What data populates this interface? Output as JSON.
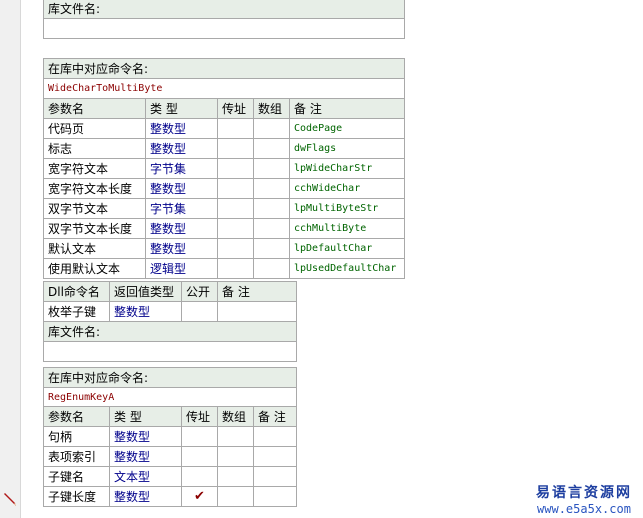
{
  "lib_file_label": "库文件名:",
  "lib_command_label": "在库中对应命令名:",
  "t1": {
    "command_name": "WideCharToMultiByte",
    "headers": [
      "参数名",
      "类 型",
      "传址",
      "数组",
      "备 注"
    ],
    "rows": [
      {
        "name": "代码页",
        "type": "整数型",
        "by_ref": "",
        "array": "",
        "note": "CodePage"
      },
      {
        "name": "标志",
        "type": "整数型",
        "by_ref": "",
        "array": "",
        "note": "dwFlags"
      },
      {
        "name": "宽字符文本",
        "type": "字节集",
        "by_ref": "",
        "array": "",
        "note": "lpWideCharStr"
      },
      {
        "name": "宽字符文本长度",
        "type": "整数型",
        "by_ref": "",
        "array": "",
        "note": "cchWideChar"
      },
      {
        "name": "双字节文本",
        "type": "字节集",
        "by_ref": "",
        "array": "",
        "note": "lpMultiByteStr"
      },
      {
        "name": "双字节文本长度",
        "type": "整数型",
        "by_ref": "",
        "array": "",
        "note": "cchMultiByte"
      },
      {
        "name": "默认文本",
        "type": "整数型",
        "by_ref": "",
        "array": "",
        "note": "lpDefaultChar"
      },
      {
        "name": "使用默认文本",
        "type": "逻辑型",
        "by_ref": "",
        "array": "",
        "note": "lpUsedDefaultChar"
      }
    ]
  },
  "t2": {
    "dll_headers": [
      "Dll命令名",
      "返回值类型",
      "公开",
      "备 注"
    ],
    "dll_row": {
      "name": "枚举子键",
      "return_type": "整数型",
      "public": "",
      "note": ""
    },
    "lib_file_value": "",
    "command_name": "RegEnumKeyA",
    "headers": [
      "参数名",
      "类 型",
      "传址",
      "数组",
      "备 注"
    ],
    "rows": [
      {
        "name": "句柄",
        "type": "整数型",
        "by_ref": "",
        "array": "",
        "note": ""
      },
      {
        "name": "表项索引",
        "type": "整数型",
        "by_ref": "",
        "array": "",
        "note": ""
      },
      {
        "name": "子键名",
        "type": "文本型",
        "by_ref": "",
        "array": "",
        "note": ""
      },
      {
        "name": "子键长度",
        "type": "整数型",
        "by_ref": "✔",
        "array": "",
        "note": ""
      }
    ]
  },
  "watermark": {
    "line1": "易语言资源网",
    "line2": "www.e5a5x.com"
  },
  "colors": {
    "header_bg": "#e7eee7",
    "border": "#a9a9a9",
    "type_blue": "#00008b",
    "note_green": "#006400",
    "command_maroon": "#8b0000"
  }
}
